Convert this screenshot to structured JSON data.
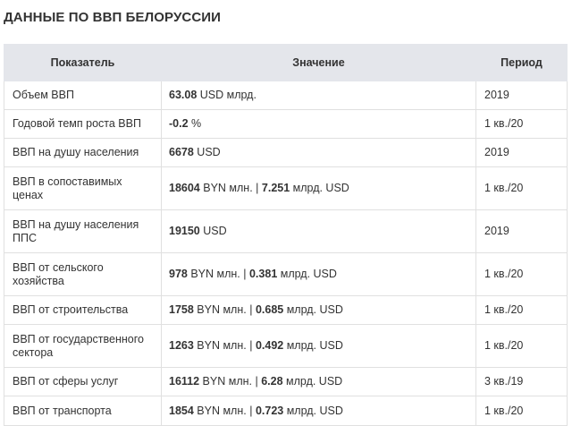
{
  "title": "ДАННЫЕ ПО ВВП БЕЛОРУССИИ",
  "table": {
    "headers": [
      "Показатель",
      "Значение",
      "Период"
    ],
    "rows": [
      {
        "indicator": "Объем ВВП",
        "v1": "63.08",
        "u1": " USD млрд.",
        "sep": "",
        "v2": "",
        "u2": "",
        "period": "2019",
        "rowtype": "single"
      },
      {
        "indicator": "Годовой темп роста ВВП",
        "v1": "-0.2",
        "u1": " %",
        "sep": "",
        "v2": "",
        "u2": "",
        "period": "1 кв./20",
        "rowtype": "single"
      },
      {
        "indicator": "ВВП на душу населения",
        "v1": "6678",
        "u1": " USD",
        "sep": "",
        "v2": "",
        "u2": "",
        "period": "2019",
        "rowtype": "single"
      },
      {
        "indicator": "ВВП в сопоставимых ценах",
        "v1": "18604",
        "u1": " BYN млн.",
        "sep": " | ",
        "v2": "7.251",
        "u2": " млрд. USD",
        "period": "1 кв./20",
        "rowtype": "double"
      },
      {
        "indicator": "ВВП на душу населения ППС",
        "v1": "19150",
        "u1": " USD",
        "sep": "",
        "v2": "",
        "u2": "",
        "period": "2019",
        "rowtype": "double"
      },
      {
        "indicator": "ВВП от сельского хозяйства",
        "v1": "978",
        "u1": " BYN млн.",
        "sep": " | ",
        "v2": "0.381",
        "u2": " млрд. USD",
        "period": "1 кв./20",
        "rowtype": "double"
      },
      {
        "indicator": "ВВП от строительства",
        "v1": "1758",
        "u1": " BYN млн.",
        "sep": " | ",
        "v2": "0.685",
        "u2": " млрд. USD",
        "period": "1 кв./20",
        "rowtype": "single"
      },
      {
        "indicator": "ВВП от государственного сектора",
        "v1": "1263",
        "u1": " BYN млн.",
        "sep": " | ",
        "v2": "0.492",
        "u2": " млрд. USD",
        "period": "1 кв./20",
        "rowtype": "double"
      },
      {
        "indicator": "ВВП от сферы услуг",
        "v1": "16112",
        "u1": " BYN млн.",
        "sep": " | ",
        "v2": "6.28",
        "u2": " млрд. USD",
        "period": "3 кв./19",
        "rowtype": "single"
      },
      {
        "indicator": "ВВП от транспорта",
        "v1": "1854",
        "u1": " BYN млн.",
        "sep": " | ",
        "v2": "0.723",
        "u2": " млрд. USD",
        "period": "1 кв./20",
        "rowtype": "short"
      }
    ]
  }
}
